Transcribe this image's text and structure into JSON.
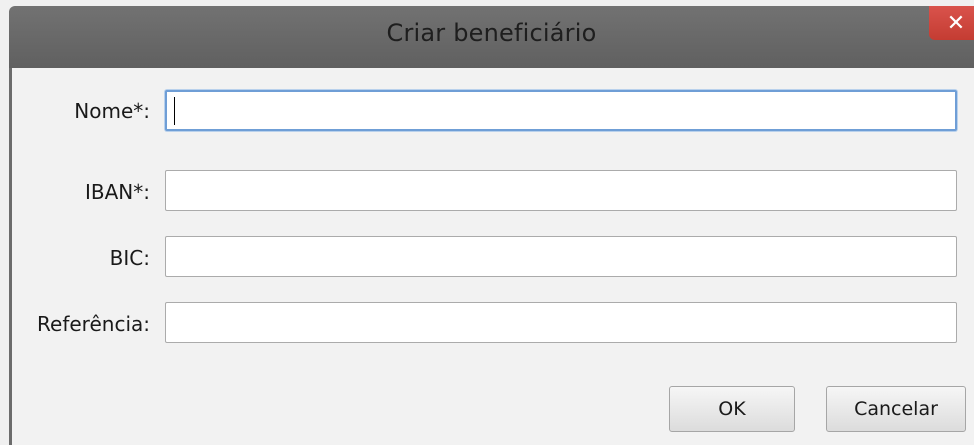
{
  "dialog": {
    "title": "Criar beneficiário",
    "close_icon": "close-icon",
    "close_glyph": "✕"
  },
  "form": {
    "fields": [
      {
        "label": "Nome*:",
        "value": ""
      },
      {
        "label": "IBAN*:",
        "value": ""
      },
      {
        "label": "BIC:",
        "value": ""
      },
      {
        "label": "Referência:",
        "value": ""
      }
    ]
  },
  "buttons": {
    "ok_label": "OK",
    "cancel_label": "Cancelar"
  },
  "colors": {
    "titlebar": "#666666",
    "close_button": "#c9463d",
    "focus_border": "#6f9ed6"
  }
}
